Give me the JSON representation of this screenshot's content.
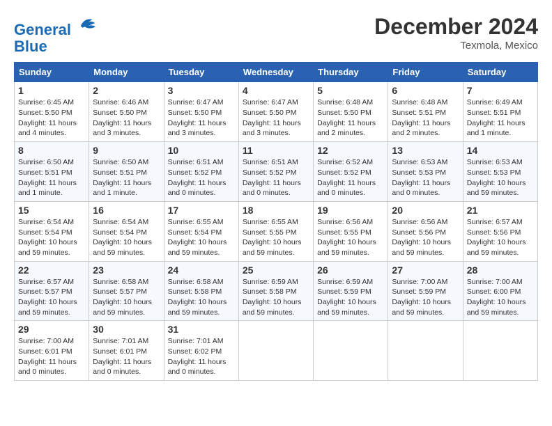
{
  "header": {
    "logo_line1": "General",
    "logo_line2": "Blue",
    "month": "December 2024",
    "location": "Texmola, Mexico"
  },
  "days_of_week": [
    "Sunday",
    "Monday",
    "Tuesday",
    "Wednesday",
    "Thursday",
    "Friday",
    "Saturday"
  ],
  "weeks": [
    [
      {
        "num": "1",
        "sunrise": "6:45 AM",
        "sunset": "5:50 PM",
        "daylight": "11 hours and 4 minutes."
      },
      {
        "num": "2",
        "sunrise": "6:46 AM",
        "sunset": "5:50 PM",
        "daylight": "11 hours and 3 minutes."
      },
      {
        "num": "3",
        "sunrise": "6:47 AM",
        "sunset": "5:50 PM",
        "daylight": "11 hours and 3 minutes."
      },
      {
        "num": "4",
        "sunrise": "6:47 AM",
        "sunset": "5:50 PM",
        "daylight": "11 hours and 3 minutes."
      },
      {
        "num": "5",
        "sunrise": "6:48 AM",
        "sunset": "5:50 PM",
        "daylight": "11 hours and 2 minutes."
      },
      {
        "num": "6",
        "sunrise": "6:48 AM",
        "sunset": "5:51 PM",
        "daylight": "11 hours and 2 minutes."
      },
      {
        "num": "7",
        "sunrise": "6:49 AM",
        "sunset": "5:51 PM",
        "daylight": "11 hours and 1 minute."
      }
    ],
    [
      {
        "num": "8",
        "sunrise": "6:50 AM",
        "sunset": "5:51 PM",
        "daylight": "11 hours and 1 minute."
      },
      {
        "num": "9",
        "sunrise": "6:50 AM",
        "sunset": "5:51 PM",
        "daylight": "11 hours and 1 minute."
      },
      {
        "num": "10",
        "sunrise": "6:51 AM",
        "sunset": "5:52 PM",
        "daylight": "11 hours and 0 minutes."
      },
      {
        "num": "11",
        "sunrise": "6:51 AM",
        "sunset": "5:52 PM",
        "daylight": "11 hours and 0 minutes."
      },
      {
        "num": "12",
        "sunrise": "6:52 AM",
        "sunset": "5:52 PM",
        "daylight": "11 hours and 0 minutes."
      },
      {
        "num": "13",
        "sunrise": "6:53 AM",
        "sunset": "5:53 PM",
        "daylight": "11 hours and 0 minutes."
      },
      {
        "num": "14",
        "sunrise": "6:53 AM",
        "sunset": "5:53 PM",
        "daylight": "10 hours and 59 minutes."
      }
    ],
    [
      {
        "num": "15",
        "sunrise": "6:54 AM",
        "sunset": "5:54 PM",
        "daylight": "10 hours and 59 minutes."
      },
      {
        "num": "16",
        "sunrise": "6:54 AM",
        "sunset": "5:54 PM",
        "daylight": "10 hours and 59 minutes."
      },
      {
        "num": "17",
        "sunrise": "6:55 AM",
        "sunset": "5:54 PM",
        "daylight": "10 hours and 59 minutes."
      },
      {
        "num": "18",
        "sunrise": "6:55 AM",
        "sunset": "5:55 PM",
        "daylight": "10 hours and 59 minutes."
      },
      {
        "num": "19",
        "sunrise": "6:56 AM",
        "sunset": "5:55 PM",
        "daylight": "10 hours and 59 minutes."
      },
      {
        "num": "20",
        "sunrise": "6:56 AM",
        "sunset": "5:56 PM",
        "daylight": "10 hours and 59 minutes."
      },
      {
        "num": "21",
        "sunrise": "6:57 AM",
        "sunset": "5:56 PM",
        "daylight": "10 hours and 59 minutes."
      }
    ],
    [
      {
        "num": "22",
        "sunrise": "6:57 AM",
        "sunset": "5:57 PM",
        "daylight": "10 hours and 59 minutes."
      },
      {
        "num": "23",
        "sunrise": "6:58 AM",
        "sunset": "5:57 PM",
        "daylight": "10 hours and 59 minutes."
      },
      {
        "num": "24",
        "sunrise": "6:58 AM",
        "sunset": "5:58 PM",
        "daylight": "10 hours and 59 minutes."
      },
      {
        "num": "25",
        "sunrise": "6:59 AM",
        "sunset": "5:58 PM",
        "daylight": "10 hours and 59 minutes."
      },
      {
        "num": "26",
        "sunrise": "6:59 AM",
        "sunset": "5:59 PM",
        "daylight": "10 hours and 59 minutes."
      },
      {
        "num": "27",
        "sunrise": "7:00 AM",
        "sunset": "5:59 PM",
        "daylight": "10 hours and 59 minutes."
      },
      {
        "num": "28",
        "sunrise": "7:00 AM",
        "sunset": "6:00 PM",
        "daylight": "10 hours and 59 minutes."
      }
    ],
    [
      {
        "num": "29",
        "sunrise": "7:00 AM",
        "sunset": "6:01 PM",
        "daylight": "11 hours and 0 minutes."
      },
      {
        "num": "30",
        "sunrise": "7:01 AM",
        "sunset": "6:01 PM",
        "daylight": "11 hours and 0 minutes."
      },
      {
        "num": "31",
        "sunrise": "7:01 AM",
        "sunset": "6:02 PM",
        "daylight": "11 hours and 0 minutes."
      },
      null,
      null,
      null,
      null
    ]
  ]
}
